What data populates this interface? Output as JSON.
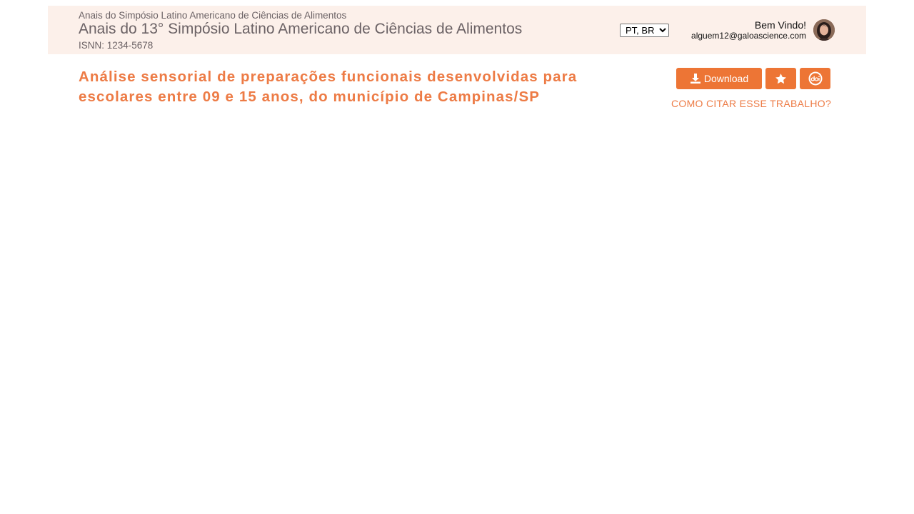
{
  "header": {
    "event_subtitle": "Anais do Simpósio Latino Americano de Ciências de Alimentos",
    "event_title": "Anais do 13° Simpósio Latino Americano de Ciências de Alimentos",
    "issn": "ISNN: 1234-5678",
    "language": {
      "selected": "PT, BR",
      "options": [
        "PT, BR"
      ]
    },
    "user": {
      "welcome": "Bem Vindo!",
      "email": "alguem12@galoascience.com",
      "avatar_icon": "user-avatar"
    }
  },
  "paper": {
    "title": "Análise sensorial de preparações funcionais desenvolvidas para escolares entre 09 e 15 anos, do município de Campinas/SP"
  },
  "actions": {
    "download_label": "Download",
    "download_icon": "download-icon",
    "favorite_icon": "star-icon",
    "doi_icon": "doi-icon",
    "cite_label": "COMO CITAR ESSE TRABALHO?"
  },
  "colors": {
    "accent": "#ed7535",
    "title": "#ed7b45",
    "header_bg": "#fcf0ea",
    "header_text": "#6b6265"
  }
}
